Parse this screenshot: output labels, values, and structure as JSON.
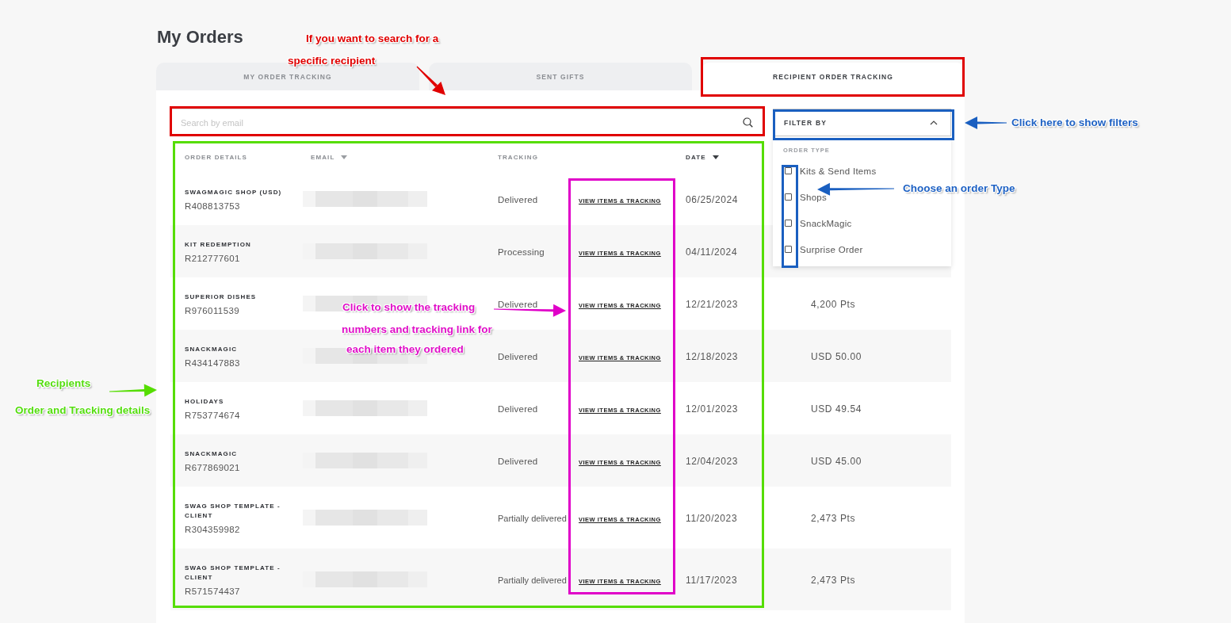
{
  "page": {
    "title": "My Orders"
  },
  "tabs": [
    {
      "label": "MY ORDER TRACKING",
      "selected": false
    },
    {
      "label": "SENT GIFTS",
      "selected": false
    },
    {
      "label": "RECIPIENT ORDER TRACKING",
      "selected": true
    }
  ],
  "search": {
    "placeholder": "Search by email"
  },
  "filter": {
    "label": "FILTER BY",
    "expanded": true,
    "section": "ORDER TYPE",
    "options": [
      {
        "label": "Kits & Send Items",
        "checked": false
      },
      {
        "label": "Shops",
        "checked": false
      },
      {
        "label": "SnackMagic",
        "checked": false
      },
      {
        "label": "Surprise Order",
        "checked": false
      }
    ]
  },
  "table": {
    "columns": [
      {
        "label": "ORDER DETAILS",
        "sort_indicator": false
      },
      {
        "label": "EMAIL",
        "sort_indicator": true
      },
      {
        "label": "TRACKING",
        "sort_indicator": false
      },
      {
        "label": "DATE",
        "sort_indicator": true
      }
    ],
    "rows": [
      {
        "name": "SWAGMAGIC SHOP (USD)",
        "order": "R408813753",
        "status": "Delivered",
        "link": "VIEW ITEMS & TRACKING",
        "date": "06/25/2024"
      },
      {
        "name": "KIT REDEMPTION",
        "order": "R212777601",
        "status": "Processing",
        "link": "VIEW ITEMS & TRACKING",
        "date": "04/11/2024"
      },
      {
        "name": "SUPERIOR DISHES",
        "order": "R976011539",
        "status": "Delivered",
        "link": "VIEW ITEMS & TRACKING",
        "date": "12/21/2023",
        "amount": "4,200 Pts"
      },
      {
        "name": "SNACKMAGIC",
        "order": "R434147883",
        "status": "Delivered",
        "link": "VIEW ITEMS & TRACKING",
        "date": "12/18/2023",
        "amount": "USD 50.00"
      },
      {
        "name": "HOLIDAYS",
        "order": "R753774674",
        "status": "Delivered",
        "link": "VIEW ITEMS & TRACKING",
        "date": "12/01/2023",
        "amount": "USD 49.54"
      },
      {
        "name": "SNACKMAGIC",
        "order": "R677869021",
        "status": "Delivered",
        "link": "VIEW ITEMS & TRACKING",
        "date": "12/04/2023",
        "amount": "USD 45.00"
      },
      {
        "name": "SWAG SHOP TEMPLATE - CLIENT",
        "order": "R304359982",
        "status": "Partially delivered",
        "link": "VIEW ITEMS & TRACKING",
        "date": "11/20/2023",
        "amount": "2,473 Pts"
      },
      {
        "name": "SWAG SHOP TEMPLATE - CLIENT",
        "order": "R571574437",
        "status": "Partially delivered",
        "link": "VIEW ITEMS & TRACKING",
        "date": "11/17/2023",
        "amount": "2,473 Pts"
      }
    ]
  },
  "annotations": {
    "notes": [
      {
        "lines": [
          "If you want to search for a",
          "specific recipient"
        ],
        "color": "#e00000"
      },
      {
        "lines": [
          "Click here to show filters"
        ],
        "color": "#1f62c4"
      },
      {
        "lines": [
          "Choose an order Type"
        ],
        "color": "#1f62c4"
      },
      {
        "lines": [
          "Click to show the tracking",
          "numbers and tracking link for",
          "each item they ordered"
        ],
        "color": "#e010c8"
      },
      {
        "lines": [
          "Recipients",
          "Order and Tracking details"
        ],
        "color": "#55dd10"
      }
    ],
    "frames": [
      {
        "color": "#e00000"
      },
      {
        "color": "#e00000"
      },
      {
        "color": "#1a5fc0"
      },
      {
        "color": "#1a5fc0"
      },
      {
        "color": "#55dd00"
      },
      {
        "color": "#e000c8"
      }
    ],
    "arrows": [
      {
        "color": "#e00000"
      },
      {
        "color": "#1a5fc0"
      },
      {
        "color": "#1a5fc0"
      },
      {
        "color": "#e000c8"
      },
      {
        "color": "#55dd00"
      }
    ]
  }
}
